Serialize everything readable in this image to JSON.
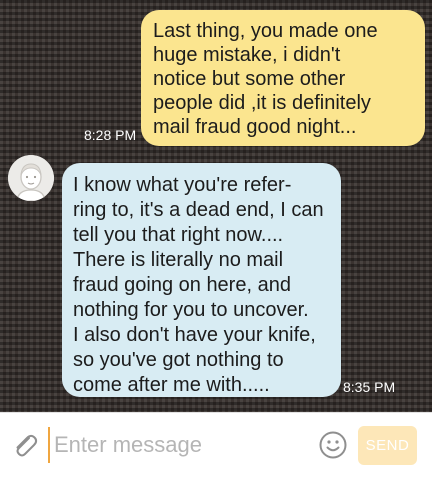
{
  "conversation": {
    "messages": [
      {
        "direction": "outgoing",
        "text": "Last thing, you made one\nhuge mistake,  i didn't\nnotice but some other\npeople did ,it is definitely\nmail fraud good night...",
        "time": "8:28 PM"
      },
      {
        "direction": "incoming",
        "text": "I know what you're refer-\nring to, it's a dead end, I can\ntell you that right now....\nThere is literally no mail\nfraud going on here, and\nnothing for you to uncover.\nI also don't have your knife,\nso you've got nothing to\ncome after me with.....",
        "time": "8:35 PM"
      }
    ]
  },
  "composer": {
    "placeholder": "Enter message",
    "value": "",
    "send_label": "SEND",
    "attach_icon": "paperclip-icon",
    "emoji_icon": "smiley-icon"
  },
  "colors": {
    "outgoing_bubble": "#fbe58f",
    "incoming_bubble": "#d8ecf3",
    "send_button": "#fde7b8",
    "cursor": "#f0a640"
  }
}
